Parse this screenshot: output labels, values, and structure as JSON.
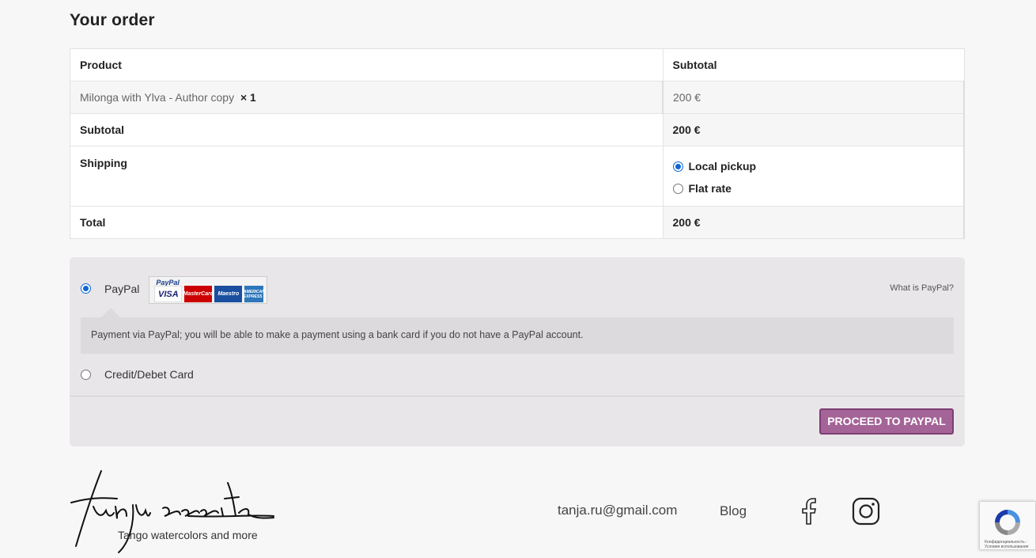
{
  "heading": "Your order",
  "table": {
    "col_product": "Product",
    "col_subtotal": "Subtotal",
    "item": {
      "name": "Milonga with Ylva - Author copy",
      "qty": "× 1",
      "price": "200 €"
    },
    "subtotal_label": "Subtotal",
    "subtotal_value": "200 €",
    "shipping_label": "Shipping",
    "shipping_options": [
      {
        "label": "Local pickup",
        "selected": true
      },
      {
        "label": "Flat rate",
        "selected": false
      }
    ],
    "total_label": "Total",
    "total_value": "200 €"
  },
  "payment": {
    "methods": [
      {
        "label": "PayPal",
        "selected": true
      },
      {
        "label": "Credit/Debet Card",
        "selected": false
      }
    ],
    "paypal_badge": {
      "logo": "PayPal",
      "cards": [
        "VISA",
        "MasterCard",
        "Maestro",
        "AMERICAN EXPRESS"
      ]
    },
    "what_is_paypal": "What is PayPal?",
    "description": "Payment via PayPal; you will be able to make a payment using a bank card if you do not have a PayPal account.",
    "proceed_label": "PROCEED TO PAYPAL"
  },
  "footer": {
    "tagline": "Tango watercolors and more",
    "email": "tanja.ru@gmail.com",
    "blog": "Blog",
    "icons": [
      "facebook-icon",
      "instagram-icon"
    ]
  },
  "recaptcha": {
    "text": "Конфиденциальность - Условия использования"
  },
  "colors": {
    "accent": "#a46497",
    "radio": "#0b67d6",
    "payment_bg": "#e9e6ea"
  }
}
